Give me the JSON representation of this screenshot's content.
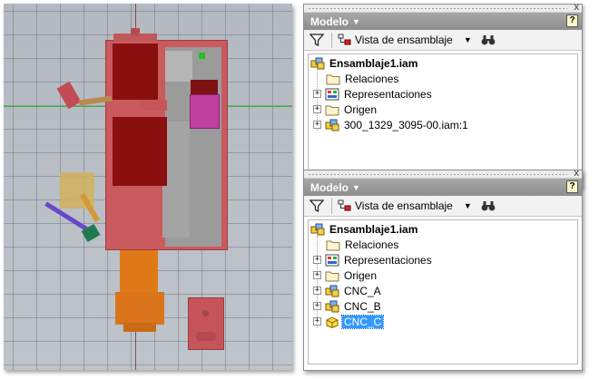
{
  "panels": [
    {
      "id": "top",
      "title": "Modelo",
      "view_label": "Vista de ensamblaje",
      "root_label": "Ensamblaje1.iam",
      "items": [
        {
          "label": "Relaciones",
          "icon": "folder-icon",
          "expandable": false
        },
        {
          "label": "Representaciones",
          "icon": "representations-icon",
          "expandable": true
        },
        {
          "label": "Origen",
          "icon": "folder-icon",
          "expandable": true
        },
        {
          "label": "300_1329_3095-00.iam:1",
          "icon": "assembly-icon",
          "expandable": true
        }
      ]
    },
    {
      "id": "bottom",
      "title": "Modelo",
      "view_label": "Vista de ensamblaje",
      "root_label": "Ensamblaje1.iam",
      "items": [
        {
          "label": "Relaciones",
          "icon": "folder-icon",
          "expandable": false
        },
        {
          "label": "Representaciones",
          "icon": "representations-icon",
          "expandable": true
        },
        {
          "label": "Origen",
          "icon": "folder-icon",
          "expandable": true
        },
        {
          "label": "CNC_A",
          "icon": "assembly-icon",
          "expandable": true
        },
        {
          "label": "CNC_B",
          "icon": "assembly-icon",
          "expandable": true
        },
        {
          "label": "CNC_C",
          "icon": "part-icon",
          "expandable": true,
          "selected": true
        }
      ]
    }
  ],
  "icons": {
    "help": "?",
    "close": "x",
    "dropdown": "▼",
    "expand": "+"
  },
  "colors": {
    "panel_header": "#9a9a9a",
    "selection": "#3399ff",
    "assembly_red": "#c95a5e",
    "dark_red": "#8a0f0f",
    "orange": "#e07a18",
    "magenta": "#c040a0",
    "grey_part": "#9b9b9b",
    "axis_green": "#2fbf33"
  }
}
